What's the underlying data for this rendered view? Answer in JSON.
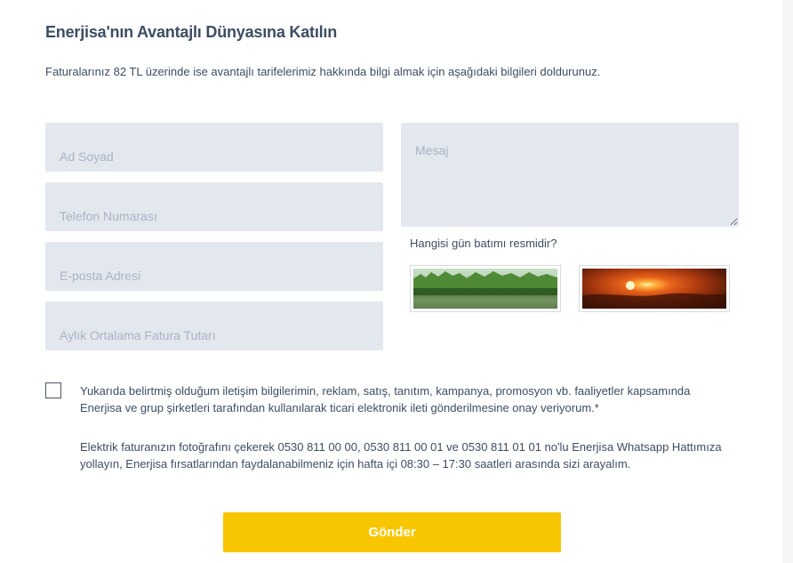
{
  "form": {
    "title": "Enerjisa'nın Avantajlı Dünyasına Katılın",
    "subtitle": "Faturalarınız 82 TL üzerinde ise avantajlı tarifelerimiz hakkında bilgi almak için aşağıdaki bilgileri doldurunuz.",
    "fields": {
      "name_placeholder": "Ad Soyad",
      "phone_placeholder": "Telefon Numarası",
      "email_placeholder": "E-posta Adresi",
      "bill_placeholder": "Aylık Ortalama Fatura Tutarı",
      "message_placeholder": "Mesaj"
    },
    "captcha": {
      "question": "Hangisi gün batımı resmidir?",
      "options": [
        "forest-image",
        "sunset-image"
      ]
    },
    "consent_text": "Yukarıda belirtmiş olduğum iletişim bilgilerimin, reklam, satış, tanıtım, kampanya, promosyon vb. faaliyetler kapsamında Enerjisa ve grup şirketleri tarafından kullanılarak ticari elektronik ileti gönderilmesine onay veriyorum.*",
    "consent_checked": false,
    "info_text": "Elektrik faturanızın fotoğrafını çekerek 0530 811 00 00, 0530 811 00 01 ve 0530 811 01 01 no'lu Enerjisa Whatsapp Hattımıza yollayın, Enerjisa fırsatlarından faydalanabilmeniz için hafta içi 08:30 – 17:30 saatleri arasında sizi arayalım.",
    "submit_label": "Gönder"
  },
  "colors": {
    "accent": "#f8c600",
    "field_bg": "#e3e7ee",
    "text": "#3d4d63",
    "placeholder": "#a9b4c4"
  }
}
